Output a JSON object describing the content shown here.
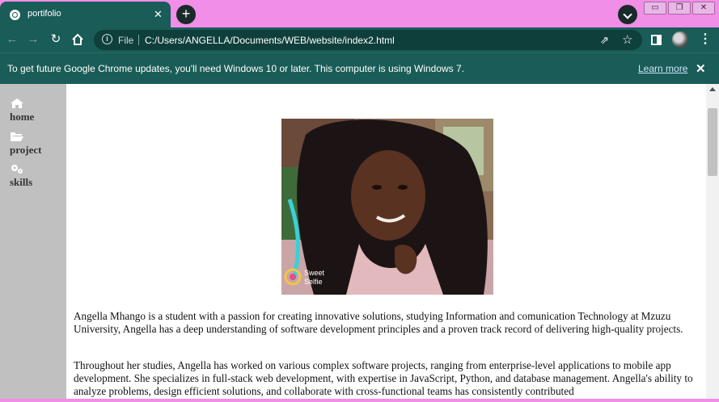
{
  "browser": {
    "tab_title": "portifolio",
    "tab_close": "✕",
    "new_tab": "+",
    "window_buttons": [
      "▭",
      "❐",
      "✕"
    ],
    "address_prefix": "File",
    "url": "C:/Users/ANGELLA/Documents/WEB/website/index2.html",
    "info_icon": "i",
    "menu": "⋮"
  },
  "infobar": {
    "message": "To get future Google Chrome updates, you'll need Windows 10 or later. This computer is using Windows 7.",
    "link": "Learn more",
    "close": "✕"
  },
  "sidebar": {
    "items": [
      {
        "label": "home",
        "icon": "home-icon"
      },
      {
        "label": "project",
        "icon": "folder-open-icon"
      },
      {
        "label": "skills",
        "icon": "gears-icon"
      }
    ]
  },
  "photo": {
    "watermark_line1": "Sweet",
    "watermark_line2": "Selfie"
  },
  "main": {
    "paragraph1": "Angella Mhango is a student with a passion for creating innovative solutions, studying Information and comunication Technology at Mzuzu University, Angella has a deep understanding of software development principles and a proven track record of delivering high-quality projects.",
    "paragraph2": "Throughout her studies, Angella has worked on various complex software projects, ranging from enterprise-level applications to mobile app development. She specializes in full-stack web development, with expertise in JavaScript, Python, and database management. Angella's ability to analyze problems, design efficient solutions, and collaborate with cross-functional teams has consistently contributed"
  },
  "colors": {
    "chrome_frame": "#f08ee8",
    "toolbar": "#1a5c57",
    "sidebar_bg": "#c0c0c0"
  }
}
